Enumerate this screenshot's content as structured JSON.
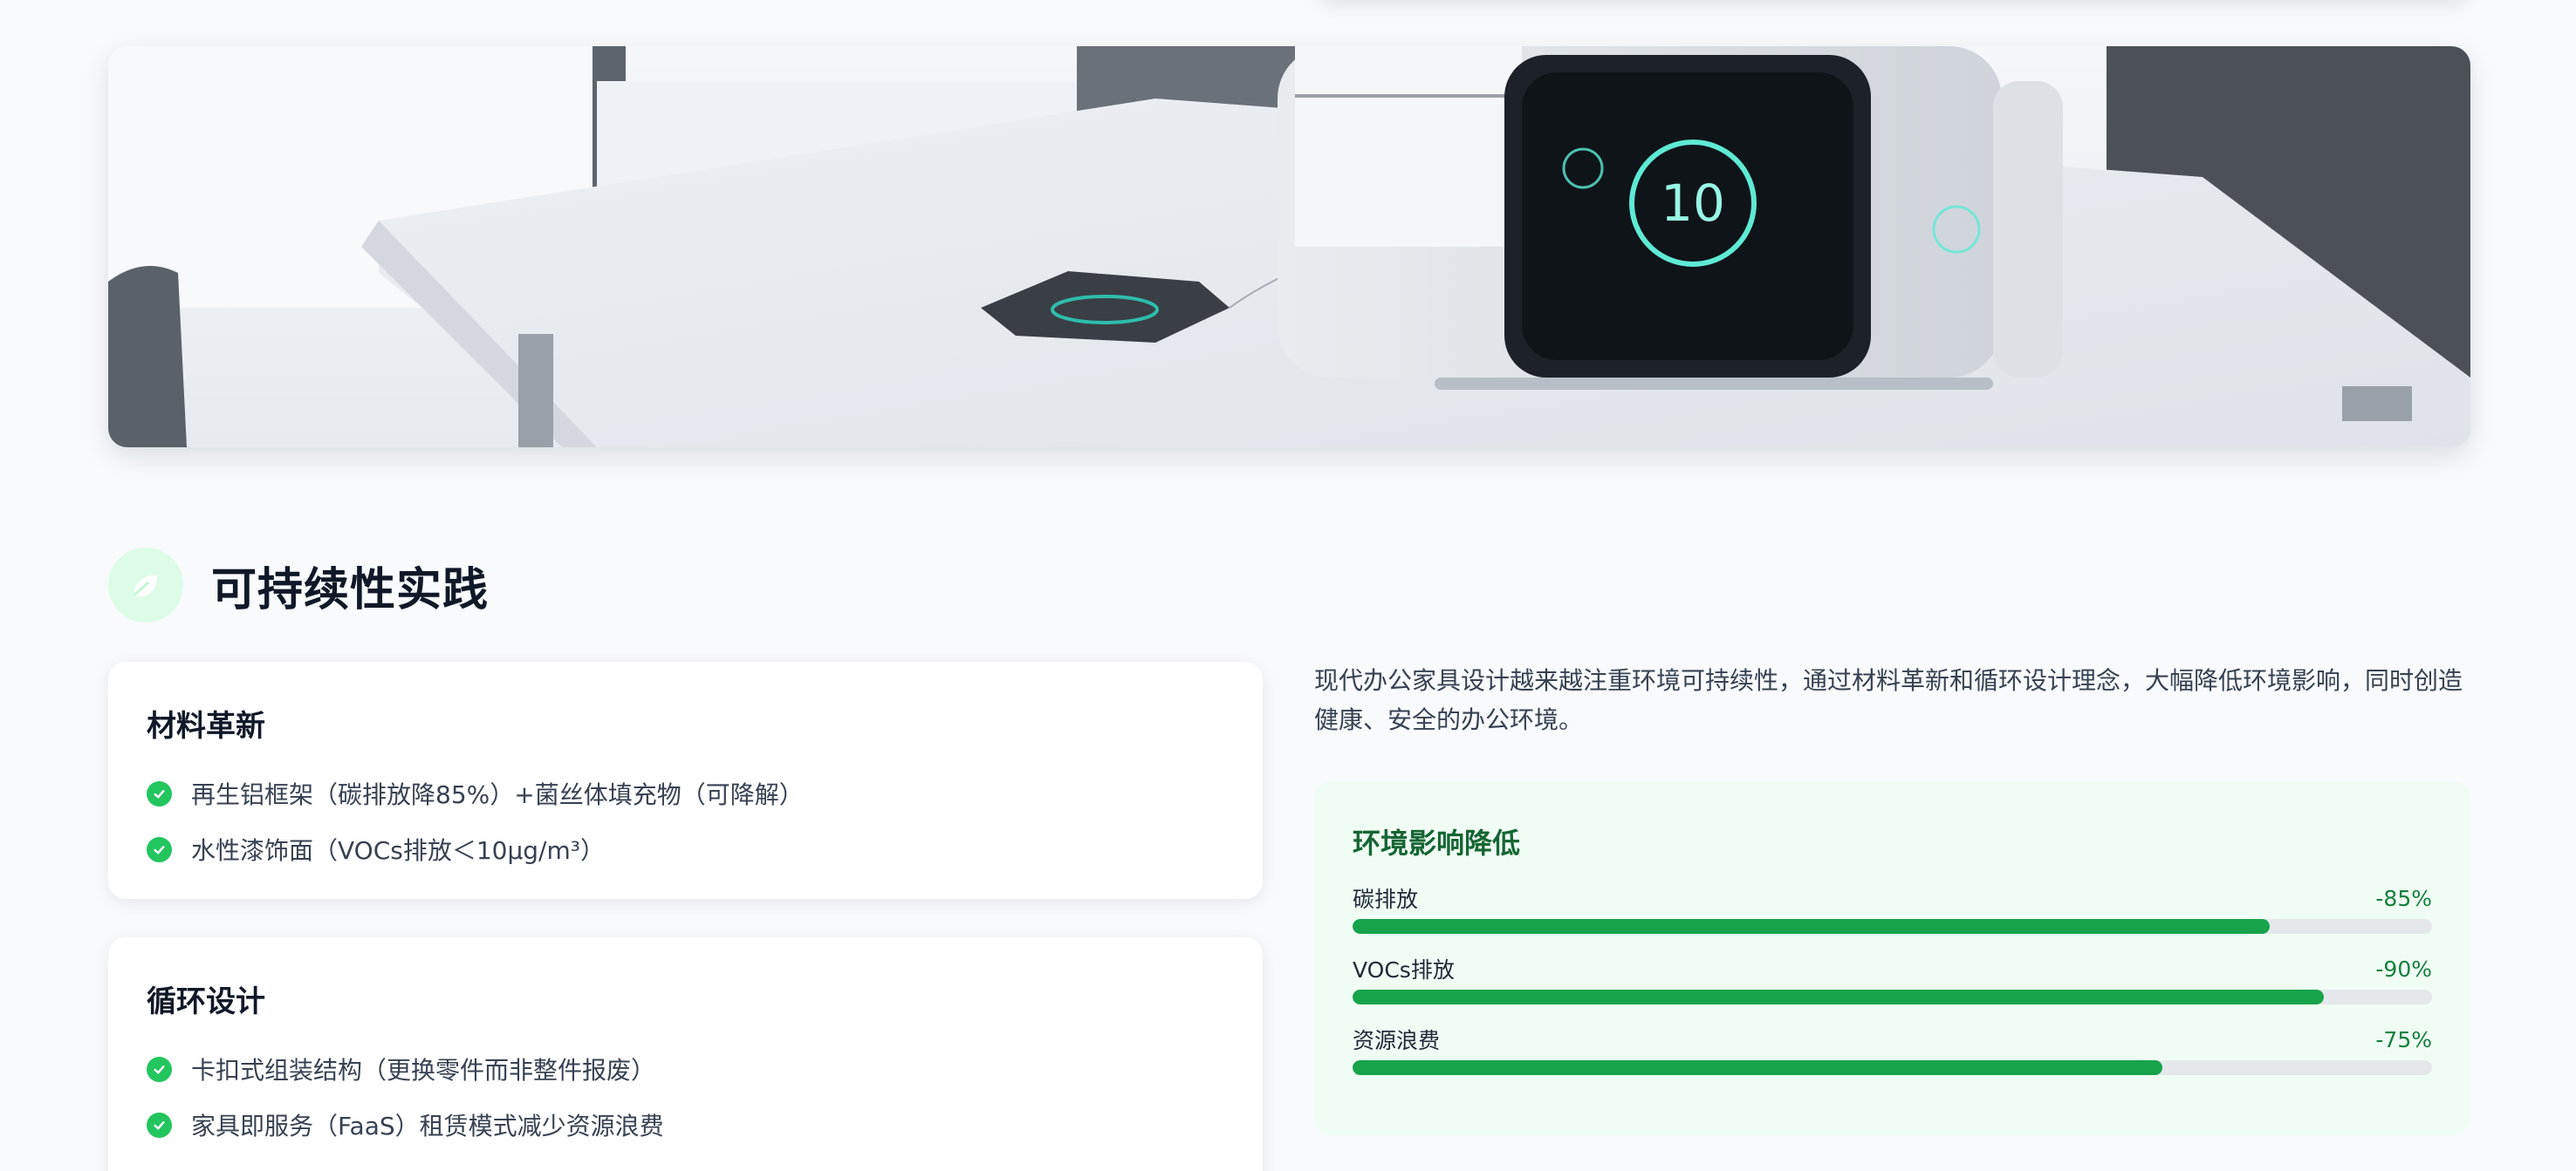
{
  "section": {
    "title": "可持续性实践",
    "icon": "leaf-icon"
  },
  "cards": [
    {
      "title": "材料革新",
      "items": [
        "再生铝框架（碳排放降85%）+菌丝体填充物（可降解）",
        "水性漆饰面（VOCs排放＜10μg/m³）"
      ]
    },
    {
      "title": "循环设计",
      "items": [
        "卡扣式组装结构（更换零件而非整件报废）",
        "家具即服务（FaaS）租赁模式减少资源浪费"
      ]
    }
  ],
  "intro": "现代办公家具设计越来越注重环境可持续性，通过材料革新和循环设计理念，大幅降低环境影响，同时创造健康、安全的办公环境。",
  "impact": {
    "title": "环境影响降低",
    "metrics": [
      {
        "label": "碳排放",
        "value": "-85%",
        "level": 0.85
      },
      {
        "label": "VOCs排放",
        "value": "-90%",
        "level": 0.9
      },
      {
        "label": "资源浪费",
        "value": "-75%",
        "level": 0.75
      }
    ]
  },
  "hero": {
    "device_display": "10"
  },
  "colors": {
    "accent": "#16a34a",
    "check": "#22c55e",
    "impact_bg": "#f0fdf4",
    "impact_title": "#166534"
  }
}
